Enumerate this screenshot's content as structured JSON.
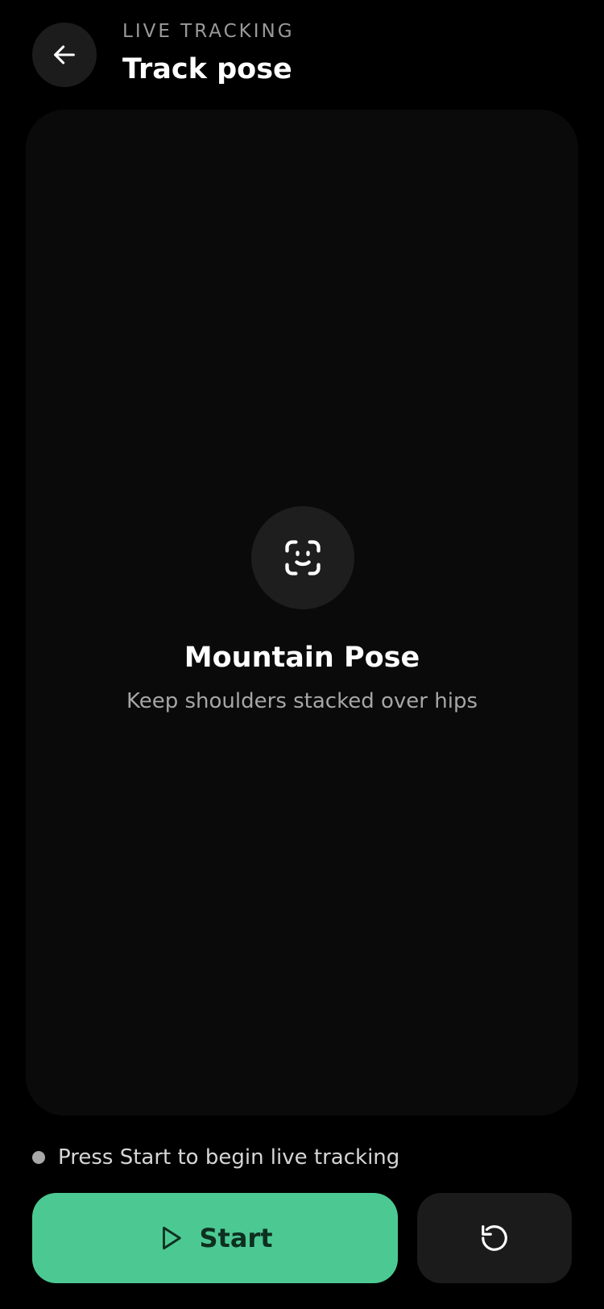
{
  "header": {
    "eyebrow": "LIVE TRACKING",
    "title": "Track pose",
    "back_icon": "arrow-left-icon"
  },
  "tracking_view": {
    "status_icon": "face-scan-icon",
    "pose_name": "Mountain Pose",
    "pose_hint": "Keep shoulders stacked over hips"
  },
  "status": {
    "text": "Press Start to begin live tracking",
    "dot_color": "#a8a8a8"
  },
  "controls": {
    "start_label": "Start",
    "start_icon": "play-icon",
    "start_color": "#4cc993",
    "reset_icon": "reset-icon"
  }
}
